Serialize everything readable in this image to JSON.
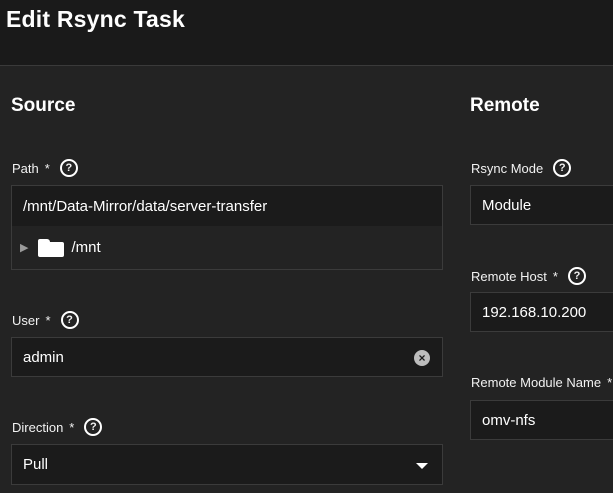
{
  "header": {
    "title": "Edit Rsync Task"
  },
  "source": {
    "title": "Source",
    "path": {
      "label": "Path",
      "required": "*",
      "value": "/mnt/Data-Mirror/data/server-transfer",
      "tree_node": "/mnt"
    },
    "user": {
      "label": "User",
      "required": "*",
      "value": "admin"
    },
    "direction": {
      "label": "Direction",
      "required": "*",
      "value": "Pull"
    }
  },
  "remote": {
    "title": "Remote",
    "rsync_mode": {
      "label": "Rsync Mode",
      "value": "Module"
    },
    "remote_host": {
      "label": "Remote Host",
      "required": "*",
      "value": "192.168.10.200"
    },
    "remote_module": {
      "label": "Remote Module Name",
      "required": "*",
      "value": "omv-nfs"
    }
  },
  "icons": {
    "help": "help-circle-icon",
    "clear": "clear-circle-icon",
    "expand": "expand-triangle-icon",
    "folder": "folder-icon",
    "dropdown": "chevron-down-icon"
  },
  "colors": {
    "background": "#232323",
    "header": "#1a1a1a",
    "field": "#1b1b1b",
    "border": "#3b3b3b",
    "text": "#ffffff"
  }
}
